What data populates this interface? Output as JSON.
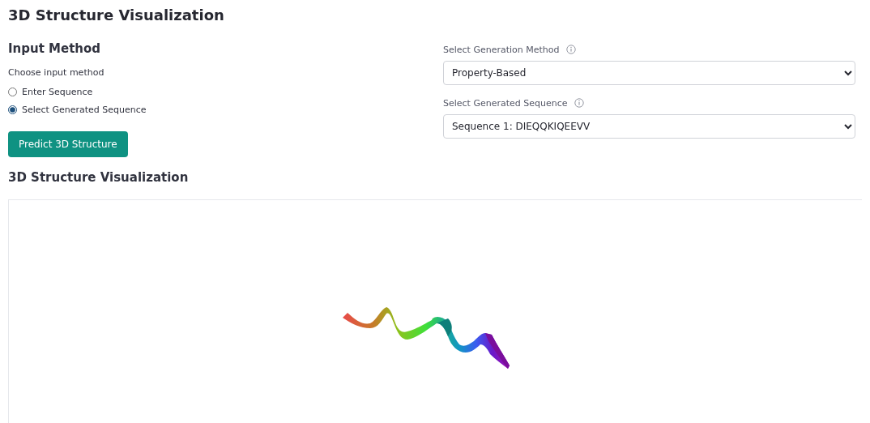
{
  "page_title": "3D Structure Visualization",
  "input_method": {
    "heading": "Input Method",
    "prompt": "Choose input method",
    "options": [
      {
        "label": "Enter Sequence",
        "selected": false
      },
      {
        "label": "Select Generated Sequence",
        "selected": true
      }
    ],
    "button": "Predict 3D Structure"
  },
  "selectors": [
    {
      "label": "Select Generation Method",
      "value": "Property-Based"
    },
    {
      "label": "Select Generated Sequence",
      "value": "Sequence 1: DIEQQKIQEEVV"
    }
  ],
  "viewer": {
    "heading": "3D Structure Visualization",
    "content": {
      "kind": "ribbon"
    }
  }
}
